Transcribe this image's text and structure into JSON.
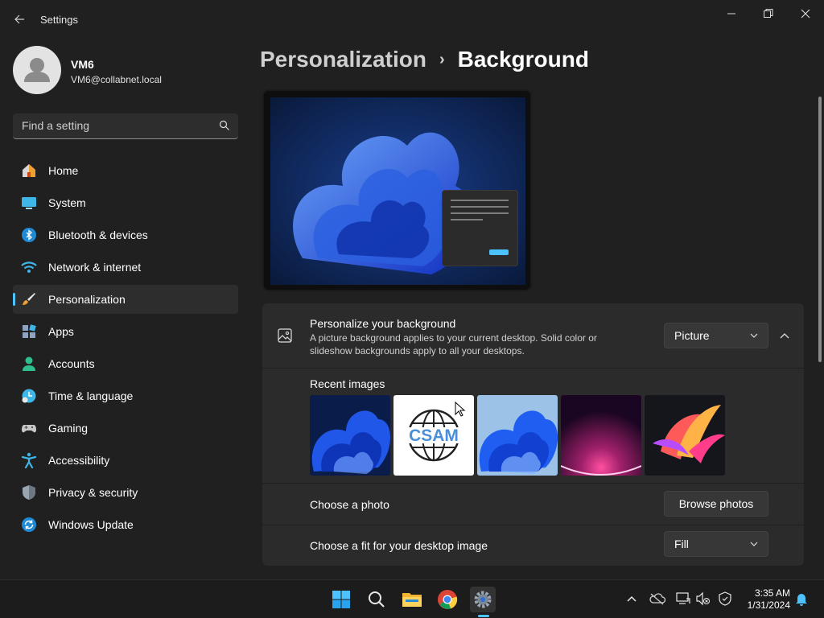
{
  "titlebar": {
    "title": "Settings"
  },
  "user": {
    "name": "VM6",
    "email": "VM6@collabnet.local"
  },
  "search": {
    "placeholder": "Find a setting"
  },
  "nav": {
    "items": [
      {
        "label": "Home",
        "icon": "home-icon"
      },
      {
        "label": "System",
        "icon": "system-icon"
      },
      {
        "label": "Bluetooth & devices",
        "icon": "bluetooth-icon"
      },
      {
        "label": "Network & internet",
        "icon": "network-icon"
      },
      {
        "label": "Personalization",
        "icon": "personalization-icon",
        "active": true
      },
      {
        "label": "Apps",
        "icon": "apps-icon"
      },
      {
        "label": "Accounts",
        "icon": "accounts-icon"
      },
      {
        "label": "Time & language",
        "icon": "time-language-icon"
      },
      {
        "label": "Gaming",
        "icon": "gaming-icon"
      },
      {
        "label": "Accessibility",
        "icon": "accessibility-icon"
      },
      {
        "label": "Privacy & security",
        "icon": "privacy-icon"
      },
      {
        "label": "Windows Update",
        "icon": "windows-update-icon"
      }
    ]
  },
  "header": {
    "parent": "Personalization",
    "separator": "›",
    "current": "Background"
  },
  "background": {
    "title": "Personalize your background",
    "description": "A picture background applies to your current desktop. Solid color or slideshow backgrounds apply to all your desktops.",
    "type_value": "Picture",
    "recent_label": "Recent images",
    "recent_images": [
      "bloom-blue-dark",
      "csam-logo",
      "bloom-blue-light",
      "purple-glow",
      "colorful-ribbons"
    ],
    "csam_text": "CSAM",
    "choose_photo_label": "Choose a photo",
    "browse_label": "Browse photos",
    "fit_label": "Choose a fit for your desktop image",
    "fit_value": "Fill"
  },
  "taskbar": {
    "time": "3:35 AM",
    "date": "1/31/2024",
    "apps": [
      "start-icon",
      "search-icon",
      "file-explorer-icon",
      "chrome-icon",
      "settings-icon"
    ]
  },
  "colors": {
    "accent": "#4cc2ff",
    "background": "#202020",
    "card": "#2b2b2b"
  }
}
